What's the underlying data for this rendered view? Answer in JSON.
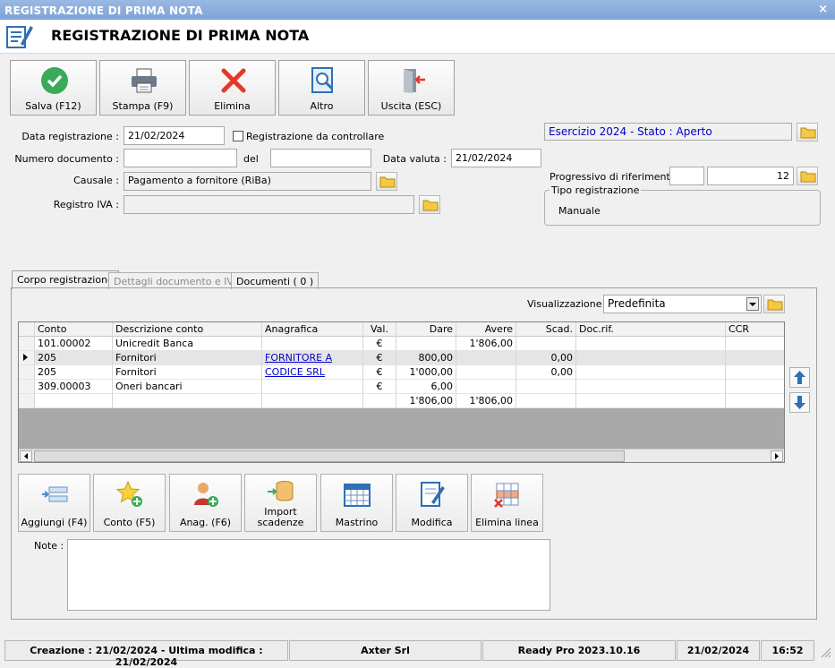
{
  "window": {
    "title": "REGISTRAZIONE DI PRIMA NOTA",
    "close": "×"
  },
  "header": {
    "title": "REGISTRAZIONE DI PRIMA NOTA"
  },
  "toolbar": {
    "salva": "Salva (F12)",
    "stampa": "Stampa (F9)",
    "elimina": "Elimina",
    "altro": "Altro",
    "uscita": "Uscita (ESC)"
  },
  "form": {
    "data_registrazione_label": "Data registrazione :",
    "data_registrazione": "21/02/2024",
    "registrazione_controllare": "Registrazione da controllare",
    "numero_documento_label": "Numero documento :",
    "numero_documento": "",
    "del_label": "del",
    "del_value": "",
    "data_valuta_label": "Data valuta :",
    "data_valuta": "21/02/2024",
    "causale_label": "Causale :",
    "causale": "Pagamento a fornitore (RiBa)",
    "registro_iva_label": "Registro IVA :",
    "registro_iva": "",
    "esercizio": "Esercizio 2024 - Stato : Aperto",
    "progressivo_label": "Progressivo di riferimento :",
    "progressivo_a": "",
    "progressivo_b": "12",
    "tipo_registrazione_label": "Tipo registrazione",
    "tipo_registrazione": "Manuale"
  },
  "tabs": [
    "Corpo registrazione",
    "Dettagli documento e IVA",
    "Documenti ( 0 )"
  ],
  "visualizzazione": {
    "label": "Visualizzazione :",
    "value": "Predefinita"
  },
  "grid": {
    "headers": [
      "Conto",
      "Descrizione conto",
      "Anagrafica",
      "Val.",
      "Dare",
      "Avere",
      "Scad.",
      "Doc.rif.",
      "CCR"
    ],
    "rows": [
      [
        "101.00002",
        "Unicredit Banca",
        "",
        "€",
        "",
        "1'806,00",
        "",
        "",
        ""
      ],
      [
        "205",
        "Fornitori",
        "FORNITORE A",
        "€",
        "800,00",
        "",
        "0,00",
        "",
        ""
      ],
      [
        "205",
        "Fornitori",
        "CODICE SRL",
        "€",
        "1'000,00",
        "",
        "0,00",
        "",
        ""
      ],
      [
        "309.00003",
        "Oneri bancari",
        "",
        "€",
        "6,00",
        "",
        "",
        "",
        ""
      ]
    ],
    "totals": {
      "dare": "1'806,00",
      "avere": "1'806,00"
    },
    "selected_row": 1
  },
  "bottom_buttons": {
    "aggiungi": "Aggiungi (F4)",
    "conto": "Conto (F5)",
    "anag": "Anag. (F6)",
    "import_1": "Import",
    "import_2": "scadenze",
    "mastrino": "Mastrino",
    "modifica": "Modifica",
    "elimina_linea": "Elimina linea"
  },
  "note": {
    "label": "Note :",
    "value": ""
  },
  "status": {
    "creazione": "Creazione : 21/02/2024 - Ultima modifica : 21/02/2024",
    "azienda": "Axter Srl",
    "versione": "Ready Pro 2023.10.16",
    "data": "21/02/2024",
    "ora": "16:52"
  },
  "colors": {
    "titlebar": "#7ea3d6",
    "accent_blue": "#0000cc",
    "check_green": "#3aaa5a",
    "delete_red": "#e03a2a"
  }
}
